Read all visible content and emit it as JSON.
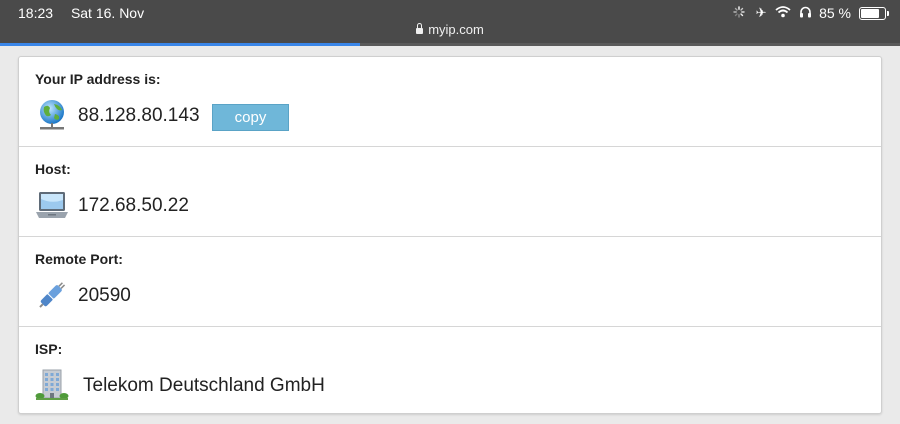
{
  "status_bar": {
    "time": "18:23",
    "date": "Sat 16. Nov",
    "battery_percent": "85 %",
    "battery_level": 0.85,
    "icons": [
      "loading-spinner-icon",
      "airplane-icon",
      "wifi-icon",
      "headphones-icon",
      "battery-icon"
    ]
  },
  "browser": {
    "url": "myip.com",
    "lock_icon": "lock-icon",
    "load_progress": 0.4,
    "accent_color": "#3a86e8"
  },
  "rows": [
    {
      "label": "Your IP address is:",
      "value": "88.128.80.143",
      "icon": "globe-network-icon",
      "button": "copy"
    },
    {
      "label": "Host:",
      "value": "172.68.50.22",
      "icon": "laptop-icon"
    },
    {
      "label": "Remote Port:",
      "value": "20590",
      "icon": "plug-connector-icon"
    },
    {
      "label": "ISP:",
      "value": "Telekom Deutschland GmbH",
      "icon": "office-building-icon"
    }
  ],
  "colors": {
    "copy_button": "#6fb7d9",
    "top_bar": "#4a4a4a"
  }
}
